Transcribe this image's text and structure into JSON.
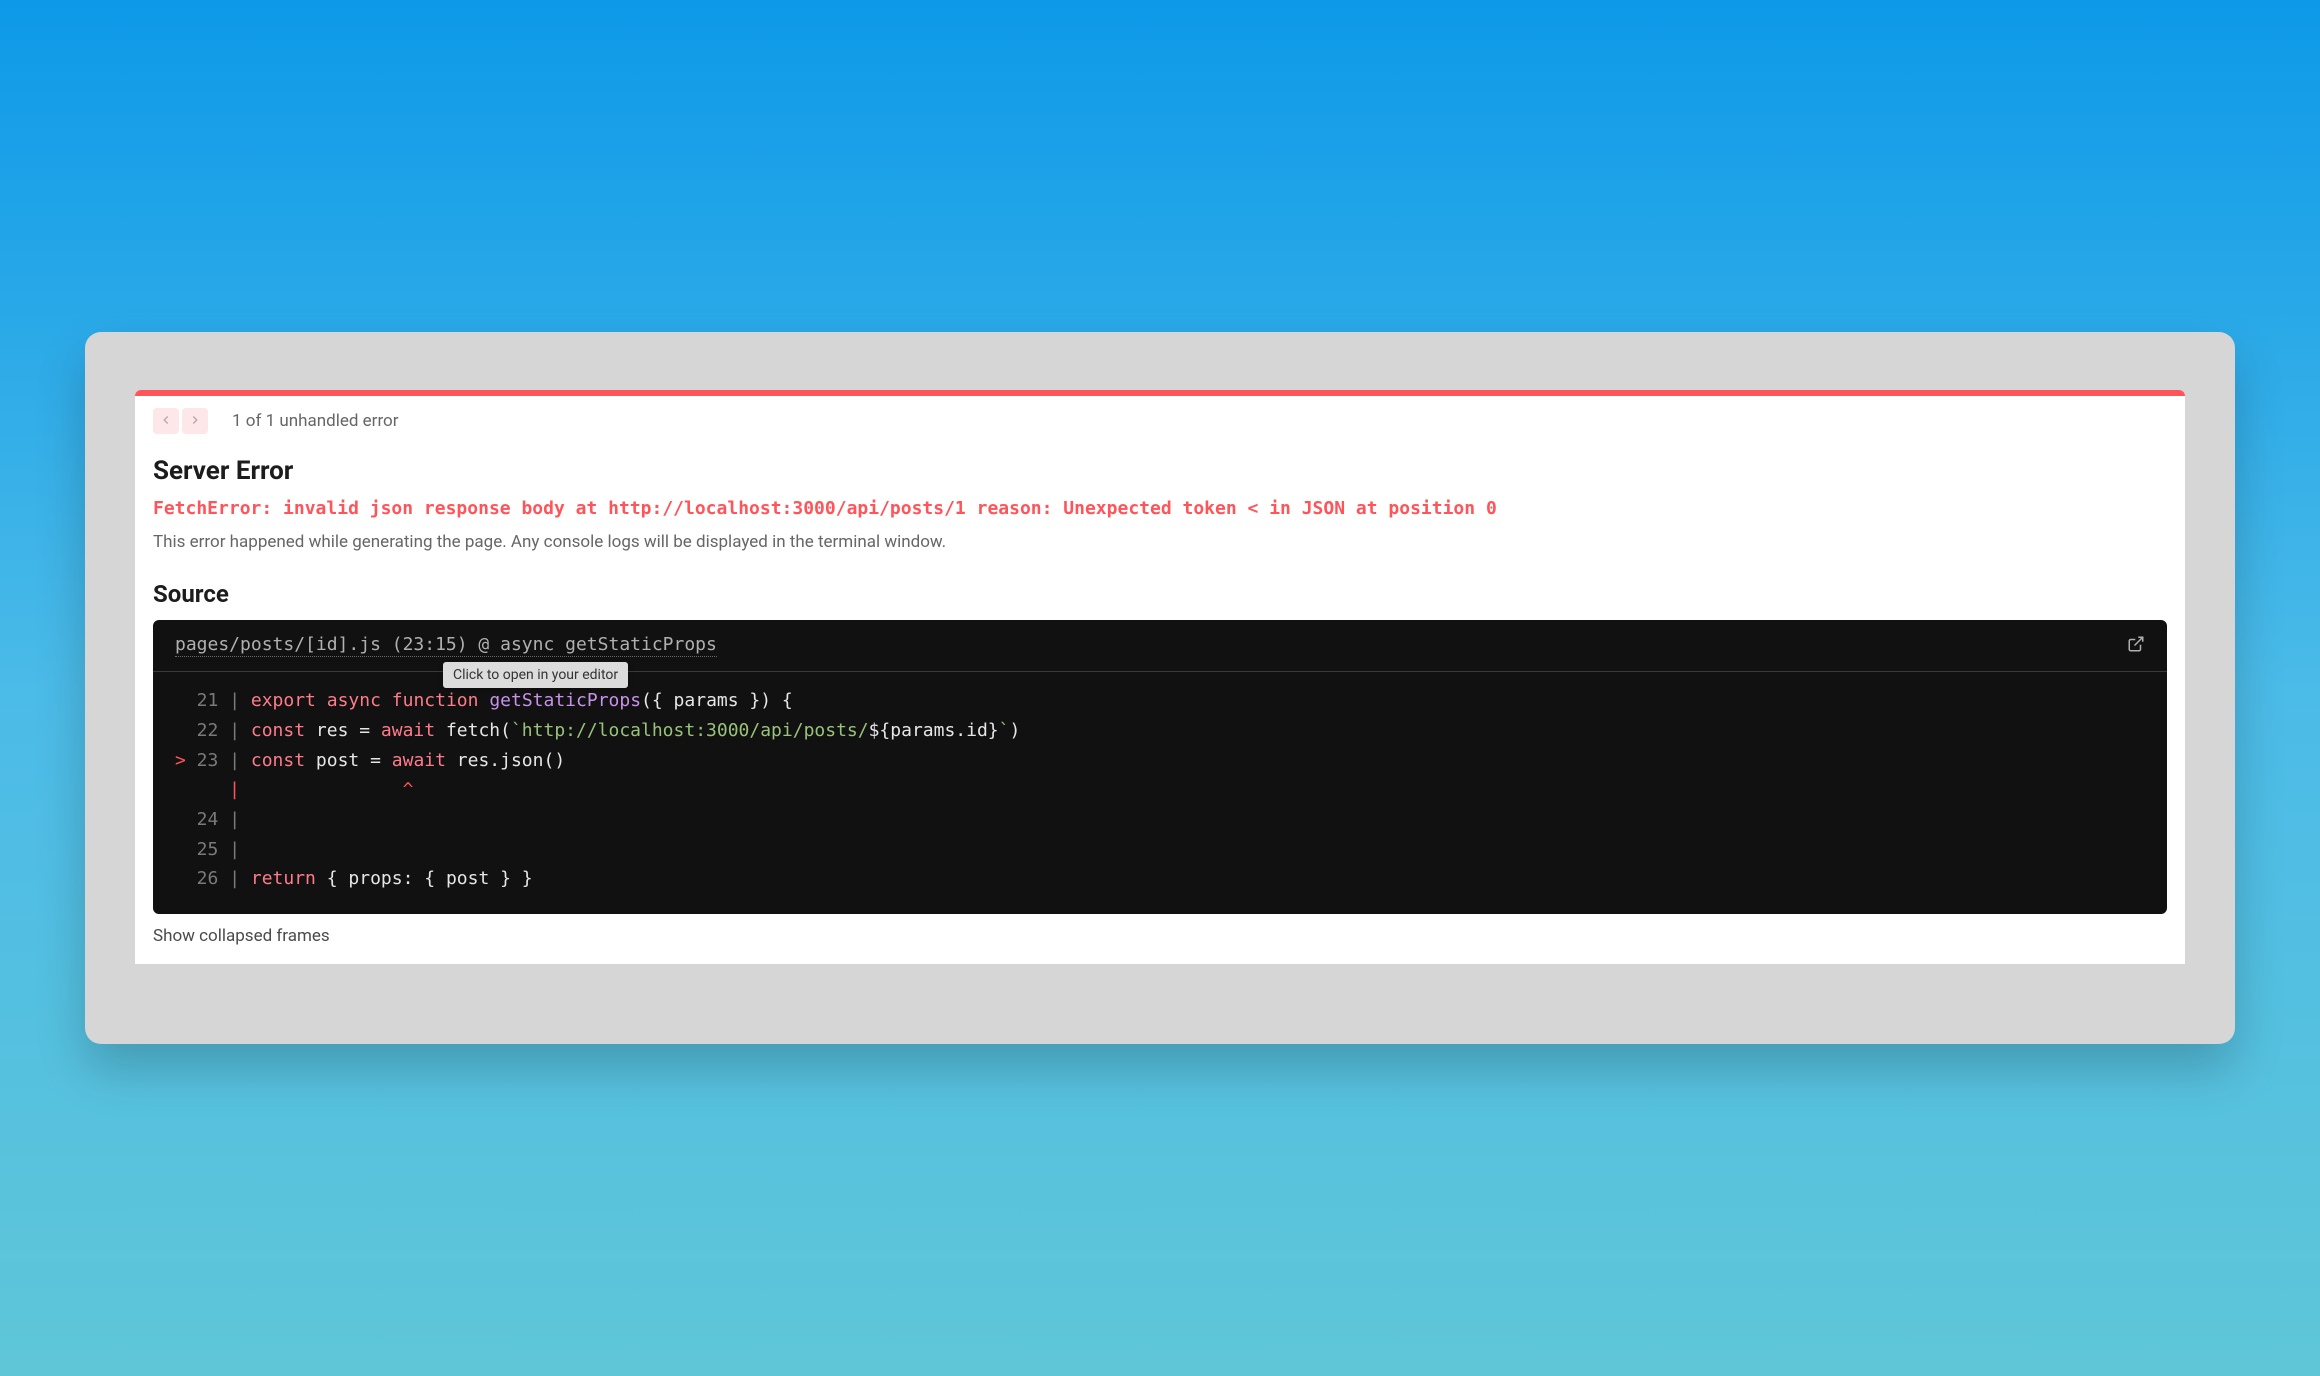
{
  "header": {
    "count_text": "1 of 1 unhandled error"
  },
  "error": {
    "title": "Server Error",
    "message": "FetchError: invalid json response body at http://localhost:3000/api/posts/1 reason: Unexpected token < in JSON at position 0",
    "hint": "This error happened while generating the page. Any console logs will be displayed in the terminal window."
  },
  "source": {
    "title": "Source",
    "file_path": "pages/posts/[id].js (23:15) @ async getStaticProps",
    "tooltip": "Click to open in your editor",
    "show_frames": "Show collapsed frames",
    "lines": {
      "l21_num": "  21",
      "l21_a": "export",
      "l21_b": "async",
      "l21_c": "function",
      "l21_d": "getStaticProps",
      "l21_e": "({ params }) {",
      "l22_num": "  22",
      "l22_a": "const",
      "l22_b": " res = ",
      "l22_c": "await",
      "l22_d": " fetch(",
      "l22_e": "`http://localhost:3000/api/posts/",
      "l22_f": "${params.id}",
      "l22_g": "`",
      "l22_h": ")",
      "l23_marker": ">",
      "l23_num": " 23",
      "l23_a": "const",
      "l23_b": " post = ",
      "l23_c": "await",
      "l23_d": " res.json()",
      "caret_line": "     |               ^",
      "l24_num": "  24",
      "l25_num": "  25",
      "l26_num": "  26",
      "l26_a": "return",
      "l26_b": " { props: { post } }"
    }
  }
}
